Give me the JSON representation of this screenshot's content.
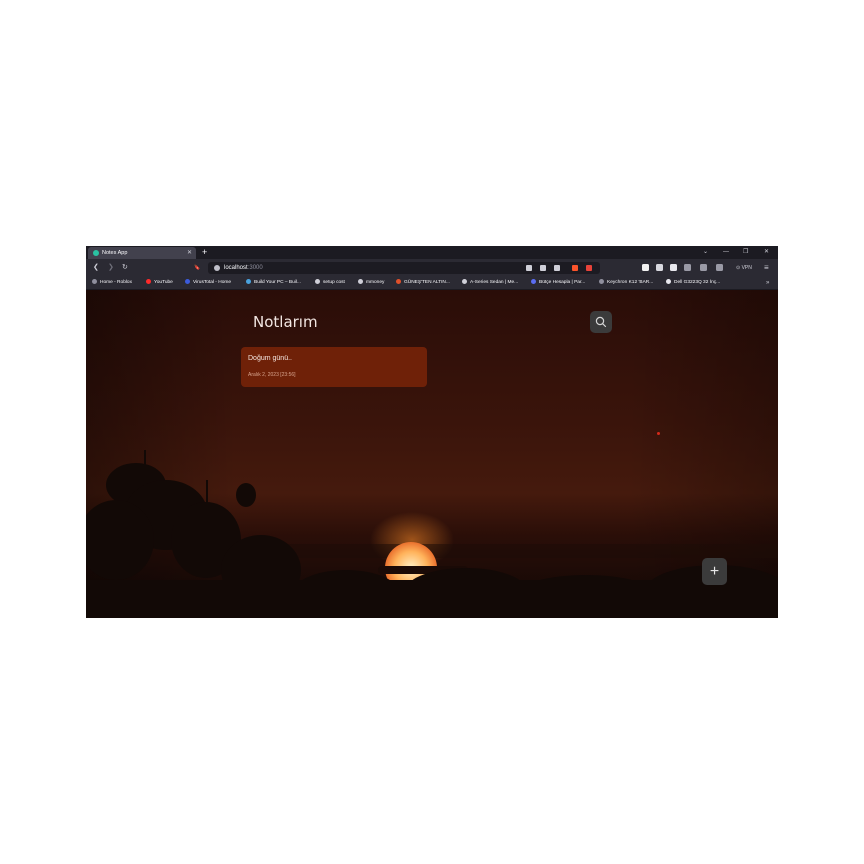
{
  "browser": {
    "tab": {
      "title": "Notes App",
      "close": "✕"
    },
    "new_tab": "+",
    "window_controls": {
      "dropdown": "⌄",
      "minimize": "—",
      "restore": "❐",
      "close": "✕"
    },
    "nav": {
      "back": "❮",
      "forward": "❯",
      "reload": "↻",
      "bookmark": "🔖"
    },
    "url": {
      "host": "localhost",
      "port": ":3000"
    },
    "vpn_label": "⊙ VPN",
    "menu": "≡",
    "bookmarks": [
      {
        "label": "Home - Roblox",
        "color": "#8f8f9d"
      },
      {
        "label": "YouTube",
        "color": "#ff2a2a"
      },
      {
        "label": "VirusTotal - Home",
        "color": "#3b5bdb"
      },
      {
        "label": "Build Your PC – Buil...",
        "color": "#4aa3df"
      },
      {
        "label": "setup cost",
        "color": "#cfcfd8"
      },
      {
        "label": "mmoney",
        "color": "#cfcfd8"
      },
      {
        "label": "GÜNEŞ'TEN ALTIN...",
        "color": "#e0502a"
      },
      {
        "label": "A-Series Sedan | Me...",
        "color": "#cfcfd8"
      },
      {
        "label": "Bütçe Hesapla | Par...",
        "color": "#5a6cf0"
      },
      {
        "label": "Keychron K12 'BAR...",
        "color": "#8f8f9d"
      },
      {
        "label": "Dell G3223Q 32 İnç...",
        "color": "#e8e8ee"
      }
    ],
    "bookmarks_more": "»"
  },
  "app": {
    "title": "Notlarım",
    "search_icon": "search-icon",
    "notes": [
      {
        "title": "Doğum günü..",
        "date": "Aralık 2, 2023 [23:56]"
      }
    ],
    "add_label": "+"
  },
  "colors": {
    "note_card": "#6f2108",
    "button_bg": "#3b3b3b"
  }
}
